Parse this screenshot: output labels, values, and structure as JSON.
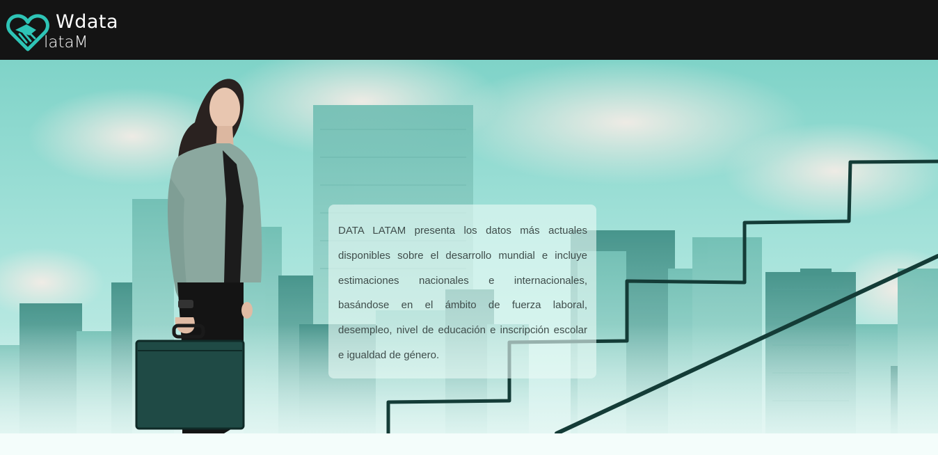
{
  "header": {
    "logo": {
      "line1": "Wdata",
      "line2": "lataM",
      "icon": "handshake-heart-icon"
    }
  },
  "hero": {
    "description": "DATA LATAM presenta los datos más actuales disponibles sobre el desarrollo mundial e incluye estimaciones nacionales e internacionales, basándose en el ámbito de fuerza laboral, desempleo, nivel de educación e inscripción escolar e igualdad de género.",
    "image": "businesswoman-with-briefcase-city-stairs-image"
  },
  "colors": {
    "header_bg": "#141414",
    "brand_accent": "#2ec4b6",
    "hero_tint": "#8fd9cf",
    "text": "#3f4d4b"
  }
}
